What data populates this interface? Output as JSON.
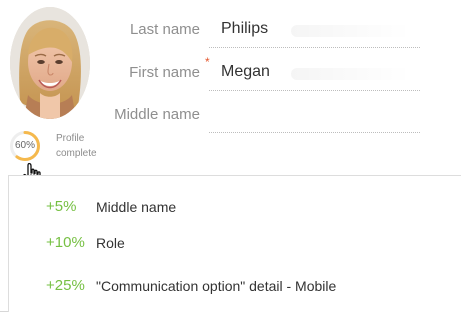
{
  "profile": {
    "fields": [
      {
        "label": "Last name",
        "value": "Philips",
        "required": false
      },
      {
        "label": "First name",
        "value": "Megan",
        "required": true
      },
      {
        "label": "Middle name",
        "value": "",
        "required": false
      }
    ],
    "required_marker": "*",
    "completion": {
      "percent_text": "60%",
      "percent_value": 60,
      "label_line1": "Profile",
      "label_line2": "complete"
    }
  },
  "completion_tips": [
    {
      "percent": "+5%",
      "description": "Middle name"
    },
    {
      "percent": "+10%",
      "description": "Role"
    },
    {
      "percent": "+25%",
      "description": "\"Communication option\" detail - Mobile"
    }
  ],
  "colors": {
    "accent_green": "#76c043",
    "progress_orange": "#f5b94d",
    "required_red": "#e4572e"
  },
  "icons": {
    "avatar": "profile-photo",
    "cursor": "hand-pointer-icon"
  }
}
